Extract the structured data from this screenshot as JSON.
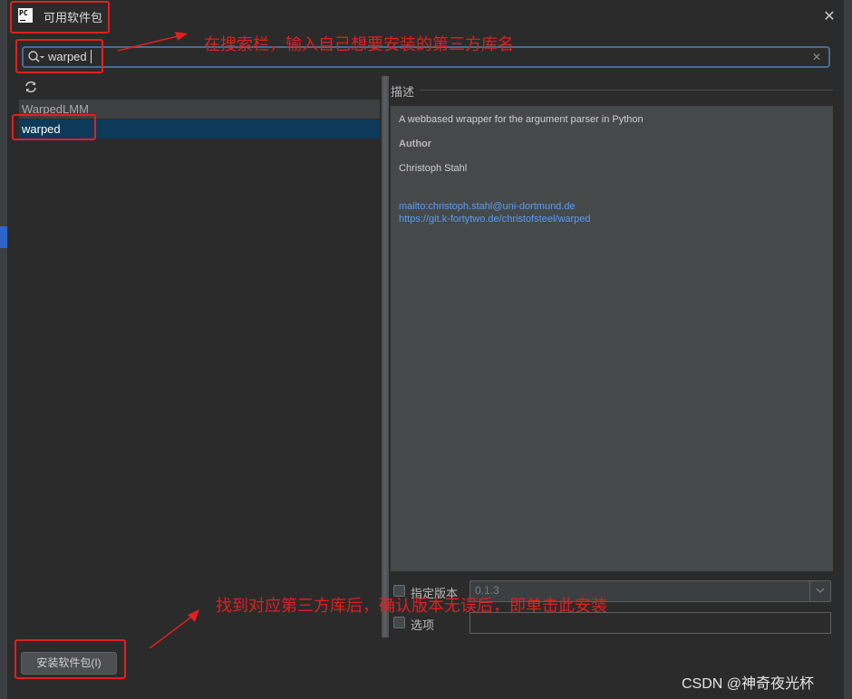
{
  "dialog": {
    "title": "可用软件包",
    "close_icon": "close-icon",
    "logo_text": "PC"
  },
  "search": {
    "value": "warped",
    "icon": "search-icon",
    "clear_icon": "clear-icon"
  },
  "package_list": {
    "refresh_icon": "refresh-icon",
    "items": [
      {
        "name": "WarpedLMM",
        "selected": false
      },
      {
        "name": "warped",
        "selected": true
      }
    ]
  },
  "description": {
    "label": "描述",
    "summary": "A webbased wrapper for the argument parser in Python",
    "author_heading": "Author",
    "author_name": "Christoph Stahl",
    "links": [
      "mailto:christoph.stahl@uni-dortmund.de",
      "https://git.k-fortytwo.de/christofsteel/warped"
    ]
  },
  "options": {
    "specify_version_label": "指定版本",
    "version_value": "0.1.3",
    "options_label": "选项",
    "options_value": ""
  },
  "install_button": {
    "label": "安装软件包(I)"
  },
  "annotations": {
    "search_hint": "在搜索栏，输入自己想要安装的第三方库名",
    "install_hint": "找到对应第三方库后，确认版本无误后，即单击此安装"
  },
  "watermark": "CSDN @神奇夜光杯",
  "colors": {
    "background": "#2b2b2b",
    "selection": "#0e3a5a",
    "link": "#589df6",
    "annotation": "#e02020"
  }
}
